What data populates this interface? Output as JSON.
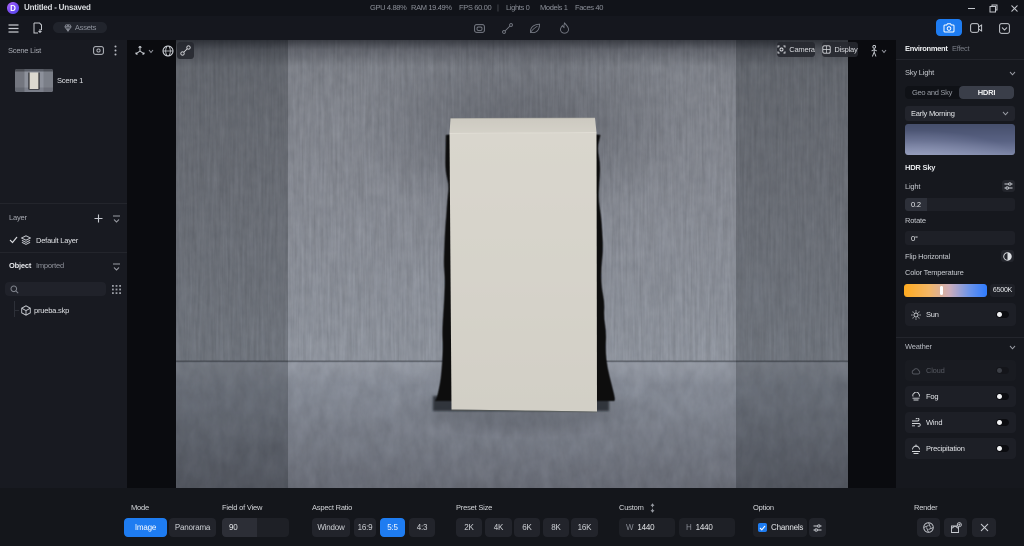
{
  "window": {
    "logo_letter": "D",
    "title": "Untitled - Unsaved",
    "stats": {
      "gpu": "GPU 4.88%",
      "ram": "RAM 19.49%",
      "fps": "FPS 60.00",
      "sep": "|",
      "lights": "Lights 0",
      "models": "Models 1",
      "faces": "Faces 40"
    }
  },
  "toolbar": {
    "assets_label": "Assets"
  },
  "scene_list": {
    "title": "Scene List",
    "scenes": [
      {
        "name": "Scene 1"
      }
    ]
  },
  "layer_panel": {
    "title": "Layer",
    "items": [
      {
        "name": "Default Layer"
      }
    ]
  },
  "object_panel": {
    "title": "Object",
    "filter": "Imported",
    "items": [
      {
        "name": "prueba.skp"
      }
    ]
  },
  "viewport": {
    "camera_label": "Camera",
    "display_label": "Display"
  },
  "environment": {
    "tabs": {
      "environment": "Environment",
      "effect": "Effect"
    },
    "sky": {
      "title": "Sky Light",
      "mode_geo": "Geo and Sky",
      "mode_hdri": "HDRI",
      "active_mode": "HDRI",
      "preset": "Early Morning",
      "hdr_sky_label": "HDR Sky",
      "light_label": "Light",
      "light_value": "0.2",
      "rotate_label": "Rotate",
      "rotate_value": "0°",
      "flip_label": "Flip Horizontal",
      "color_temp_label": "Color Temperature",
      "color_temp_value": "6500K",
      "sun_label": "Sun",
      "sun_on": false
    },
    "weather": {
      "title": "Weather",
      "rows": [
        {
          "label": "Cloud",
          "disabled": true,
          "on": false
        },
        {
          "label": "Fog",
          "disabled": false,
          "on": false
        },
        {
          "label": "Wind",
          "disabled": false,
          "on": false
        },
        {
          "label": "Precipitation",
          "disabled": false,
          "on": false
        }
      ]
    }
  },
  "render_bar": {
    "mode": {
      "label": "Mode",
      "options": [
        "Image",
        "Panorama"
      ],
      "active": "Image"
    },
    "fov": {
      "label": "Field of View",
      "value": "90"
    },
    "aspect": {
      "label": "Aspect Ratio",
      "options": [
        "Window",
        "16:9",
        "5:5",
        "4:3"
      ],
      "active": "5:5"
    },
    "preset": {
      "label": "Preset Size",
      "options": [
        "2K",
        "4K",
        "6K",
        "8K",
        "16K"
      ]
    },
    "custom": {
      "label": "Custom",
      "w_prefix": "W",
      "w_value": "1440",
      "h_prefix": "H",
      "h_value": "1440"
    },
    "option": {
      "label": "Option",
      "channels_label": "Channels",
      "channels_checked": true
    },
    "render": {
      "label": "Render"
    }
  },
  "colors": {
    "accent": "#1e7cf1",
    "panel_bg": "#16181e",
    "sidebar_bg": "#181a21",
    "viewport_wall": "#8b8f99"
  }
}
